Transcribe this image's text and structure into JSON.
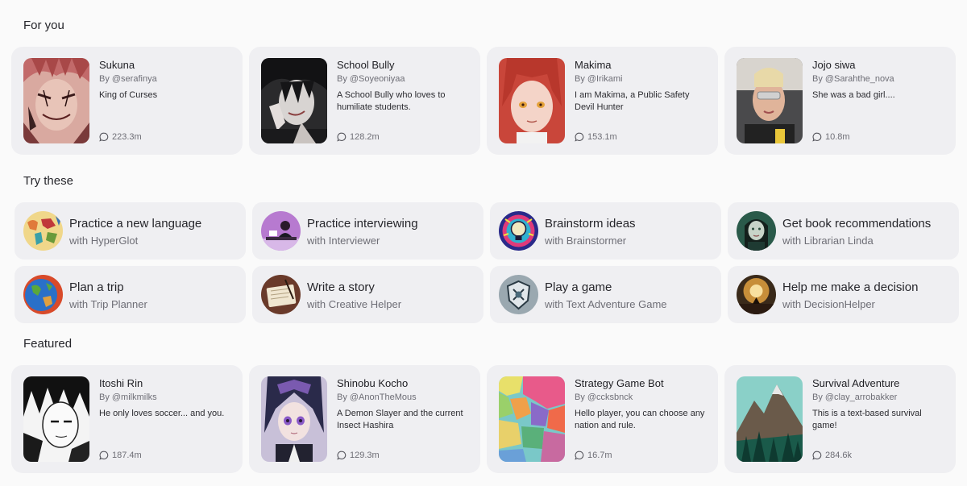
{
  "sections": {
    "for_you": "For you",
    "try_these": "Try these",
    "featured": "Featured"
  },
  "for_you": [
    {
      "name": "Sukuna",
      "author": "By @serafinya",
      "desc": "King of Curses",
      "chats": "223.3m",
      "avatar": "sukuna-avatar"
    },
    {
      "name": "School Bully",
      "author": "By @Soyeoniyaa",
      "desc": "A School Bully who loves to humiliate students.",
      "chats": "128.2m",
      "avatar": "school-bully-avatar"
    },
    {
      "name": "Makima",
      "author": "By @Irikami",
      "desc": "I am Makima, a Public Safety Devil Hunter",
      "chats": "153.1m",
      "avatar": "makima-avatar"
    },
    {
      "name": "Jojo siwa",
      "author": "By @Sarahthe_nova",
      "desc": "She was a bad girl....",
      "chats": "10.8m",
      "avatar": "jojo-siwa-avatar"
    }
  ],
  "try_these": [
    {
      "title": "Practice a new language",
      "sub": "with HyperGlot",
      "icon": "world-map-icon"
    },
    {
      "title": "Practice interviewing",
      "sub": "with Interviewer",
      "icon": "interviewer-icon"
    },
    {
      "title": "Brainstorm ideas",
      "sub": "with Brainstormer",
      "icon": "lightbulb-icon"
    },
    {
      "title": "Get book recommendations",
      "sub": "with Librarian Linda",
      "icon": "librarian-icon"
    },
    {
      "title": "Plan a trip",
      "sub": "with Trip Planner",
      "icon": "globe-icon"
    },
    {
      "title": "Write a story",
      "sub": "with Creative Helper",
      "icon": "notebook-icon"
    },
    {
      "title": "Play a game",
      "sub": "with Text Adventure Game",
      "icon": "game-shield-icon"
    },
    {
      "title": "Help me make a decision",
      "sub": "with DecisionHelper",
      "icon": "decision-icon"
    }
  ],
  "featured": [
    {
      "name": "Itoshi Rin",
      "author": "By @milkmilks",
      "desc": "He only loves soccer... and you.",
      "chats": "187.4m",
      "avatar": "itoshi-rin-avatar"
    },
    {
      "name": "Shinobu Kocho",
      "author": "By @AnonTheMous",
      "desc": "A Demon Slayer and the current Insect Hashira",
      "chats": "129.3m",
      "avatar": "shinobu-kocho-avatar"
    },
    {
      "name": "Strategy Game Bot",
      "author": "By @ccksbnck",
      "desc": "Hello player, you can choose any nation and rule.",
      "chats": "16.7m",
      "avatar": "strategy-map-avatar"
    },
    {
      "name": "Survival Adventure",
      "author": "By @clay_arrobakker",
      "desc": "This is a text-based survival game!",
      "chats": "284.6k",
      "avatar": "survival-mountain-avatar"
    }
  ]
}
